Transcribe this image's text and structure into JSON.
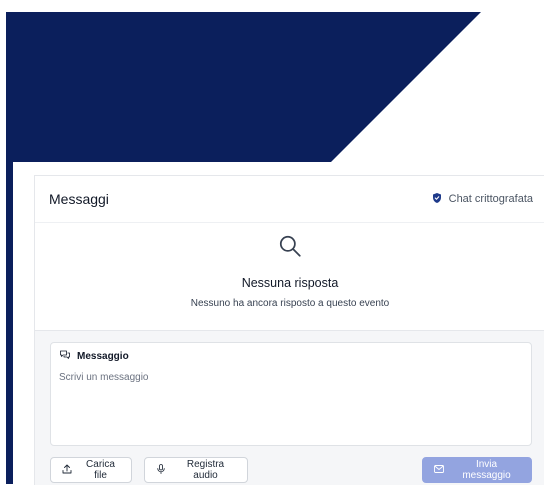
{
  "colors": {
    "banner": "#0b1f5c",
    "accent_send": "#93a4e0",
    "shield": "#1e3a8a"
  },
  "header": {
    "title": "Messaggi",
    "encrypted_label": "Chat crittografata",
    "encrypted_icon": "shield-check-icon"
  },
  "empty_state": {
    "icon": "search-icon",
    "title": "Nessuna risposta",
    "subtitle": "Nessuno ha ancora risposto a questo evento"
  },
  "composer": {
    "label": "Messaggio",
    "label_icon": "chat-bubbles-icon",
    "placeholder": "Scrivi un messaggio",
    "value": ""
  },
  "actions": {
    "upload_label": "Carica file",
    "upload_icon": "upload-icon",
    "audio_label": "Registra audio",
    "audio_icon": "microphone-icon",
    "send_label": "Invia messaggio",
    "send_icon": "mail-icon"
  }
}
